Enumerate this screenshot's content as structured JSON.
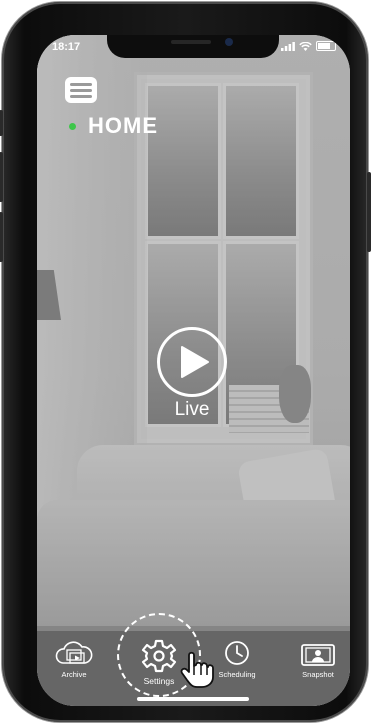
{
  "status_bar": {
    "time": "18:17"
  },
  "header": {
    "menu_icon": "hamburger-menu-icon",
    "title": "HOME",
    "status_dot_color": "#3ec64a"
  },
  "player": {
    "live_label": "Live",
    "play_icon": "play-icon"
  },
  "tabbar": {
    "tabs": [
      {
        "label": "Archive",
        "icon": "archive-icon"
      },
      {
        "label": "Settings",
        "icon": "gear-icon"
      },
      {
        "label": "Scheduling",
        "icon": "clock-icon"
      },
      {
        "label": "Snapshot",
        "icon": "snapshot-icon"
      }
    ],
    "highlighted": "Settings"
  }
}
